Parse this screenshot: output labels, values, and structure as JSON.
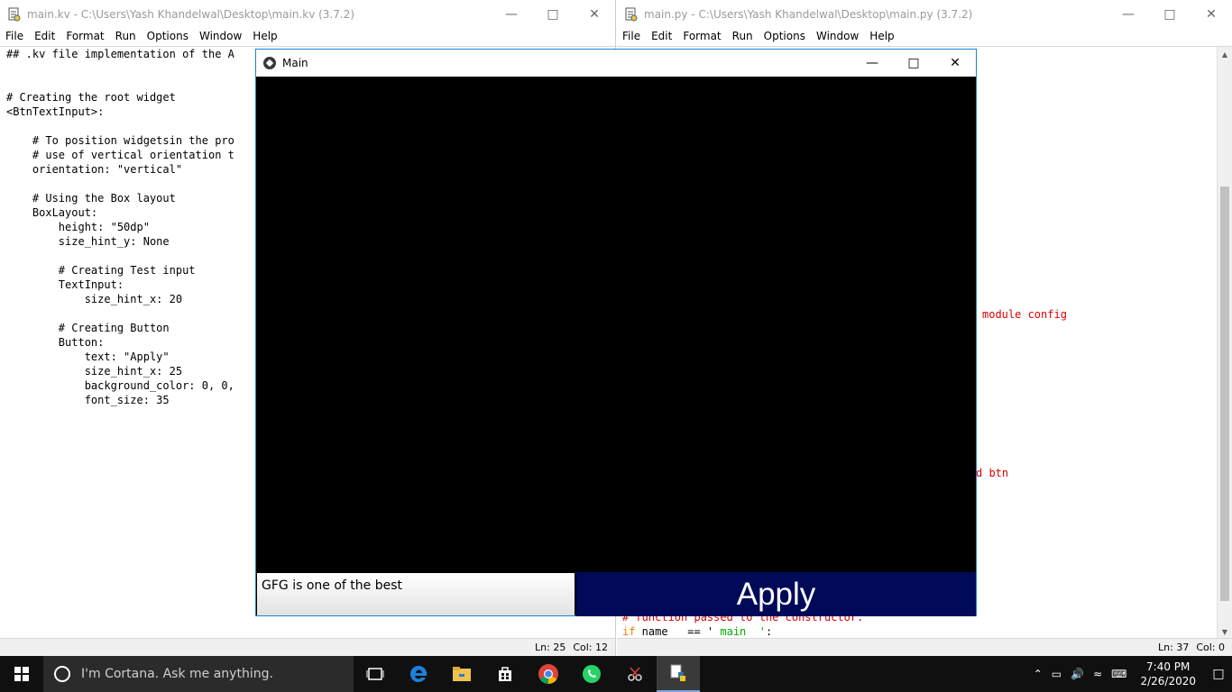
{
  "left_window": {
    "title": "main.kv - C:\\Users\\Yash Khandelwal\\Desktop\\main.kv (3.7.2)",
    "menu": [
      "File",
      "Edit",
      "Format",
      "Run",
      "Options",
      "Window",
      "Help"
    ],
    "code_lines": [
      "## .kv file implementation of the A",
      "",
      "",
      "# Creating the root widget",
      "<BtnTextInput>:",
      "",
      "    # To position widgetsin the pro",
      "    # use of vertical orientation t",
      "    orientation: \"vertical\"",
      "",
      "    # Using the Box layout",
      "    BoxLayout:",
      "        height: \"50dp\"",
      "        size_hint_y: None",
      "",
      "        # Creating Test input",
      "        TextInput:",
      "            size_hint_x: 20",
      "",
      "        # Creating Button",
      "        Button:",
      "            text: \"Apply\"",
      "            size_hint_x: 25",
      "            background_color: 0, 0,",
      "            font_size: 35"
    ],
    "status_ln": "Ln: 25",
    "status_col": "Col: 12"
  },
  "right_window": {
    "title": "main.py - C:\\Users\\Yash Khandelwal\\Desktop\\main.py (3.7.2)",
    "menu": [
      "File",
      "Edit",
      "Format",
      "Run",
      "Options",
      "Window",
      "Help"
    ],
    "fragment_module_config": "module config",
    "fragment_btn": "d btn",
    "fragment_function_passed": "# function passed to the constructor.",
    "fragment_if": "if",
    "fragment_name": " name   == '",
    "fragment_main": " main  '",
    "fragment_colon": ":",
    "status_ln": "Ln: 37",
    "status_col": "Col: 0"
  },
  "kivy_window": {
    "title": "Main",
    "text_input_value": "GFG is one of the best",
    "button_label": "Apply",
    "button_color": "#000a58"
  },
  "taskbar": {
    "search_placeholder": "I'm Cortana. Ask me anything.",
    "time": "7:40 PM",
    "date": "2/26/2020"
  }
}
